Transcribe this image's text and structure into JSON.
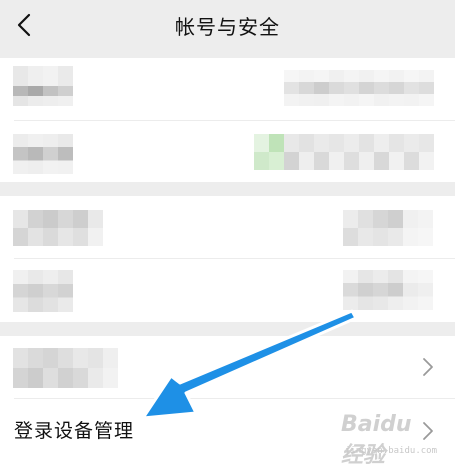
{
  "header": {
    "title": "帐号与安全",
    "back_icon": "chevron-left-icon"
  },
  "rows": {
    "device_management_label": "登录设备管理",
    "chevron_icon": "chevron-right-icon"
  },
  "watermark": {
    "main": "Baidu 经验",
    "sub": "jingyan.baidu.com"
  },
  "colors": {
    "background": "#ededed",
    "card": "#ffffff",
    "arrow": "#1e90e6",
    "blur_green": "#bfe3b8"
  }
}
